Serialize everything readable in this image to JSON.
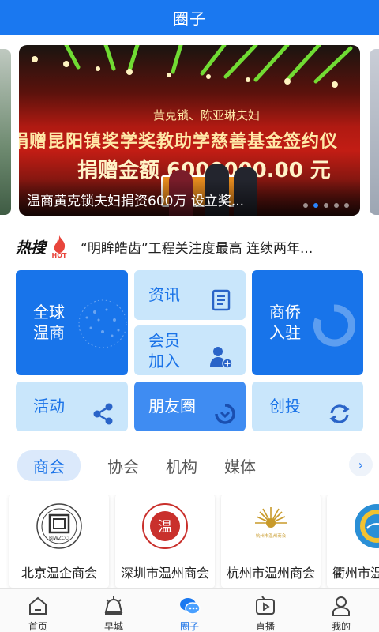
{
  "header": {
    "title": "圈子"
  },
  "banner": {
    "subtitle": "黄克锁、陈亚琳夫妇",
    "line1": "捐赠昆阳镇奖学奖教助学慈善基金签约仪",
    "line2": "捐赠金额 6000000.00 元",
    "caption": "温商黄克锁夫妇捐资600万 设立奖...",
    "slide_count": 5,
    "active_slide": 1
  },
  "hot": {
    "label": "热搜",
    "badge": "HOT",
    "text": "“明眸皓齿”工程关注度最高 连续两年..."
  },
  "tiles": {
    "global": "全球温商",
    "news": "资讯",
    "member": "会员加入",
    "settle": "商侨入驻",
    "activity": "活动",
    "moments": "朋友圈",
    "startup": "创投"
  },
  "tabs": [
    "商会",
    "协会",
    "机构",
    "媒体"
  ],
  "active_tab": 0,
  "cards": [
    {
      "name": "北京温企商会",
      "logo_text": "BJWZCCI"
    },
    {
      "name": "深圳市温州商会",
      "logo_text": "温"
    },
    {
      "name": "杭州市温州商会",
      "logo_text": "杭州市温州商会"
    },
    {
      "name": "衢州市温州商会",
      "logo_text": ""
    }
  ],
  "nav": [
    {
      "label": "首页",
      "icon": "home-icon"
    },
    {
      "label": "早城",
      "icon": "alarm-icon"
    },
    {
      "label": "圈子",
      "icon": "chat-icon"
    },
    {
      "label": "直播",
      "icon": "tv-icon"
    },
    {
      "label": "我的",
      "icon": "user-icon"
    }
  ],
  "active_nav": 2,
  "colors": {
    "brand": "#1a78f0",
    "tile_dark": "#1874ea",
    "tile_light": "#c9e6fb",
    "hot_red": "#e8453c"
  }
}
